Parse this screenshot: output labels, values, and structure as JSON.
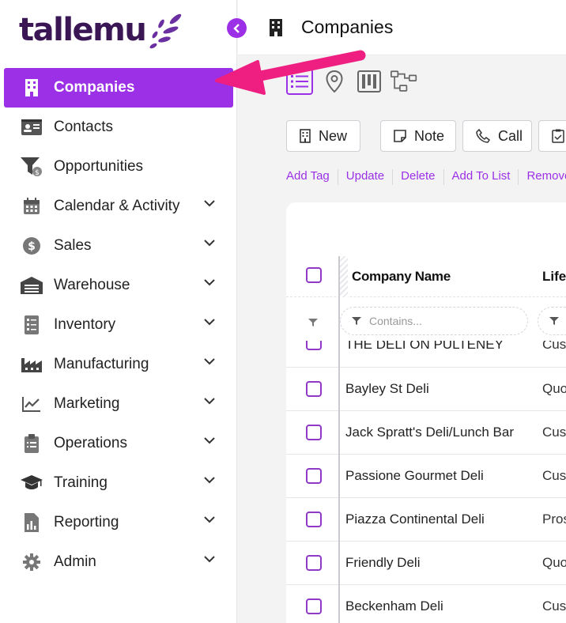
{
  "brand": {
    "name": "tallemu",
    "accent": "#9b30e6",
    "logo_color": "#3a1654"
  },
  "header": {
    "title": "Companies"
  },
  "sidebar": {
    "items": [
      {
        "label": "Companies",
        "icon": "building-icon",
        "active": true,
        "expandable": false
      },
      {
        "label": "Contacts",
        "icon": "id-card-icon",
        "expandable": false
      },
      {
        "label": "Opportunities",
        "icon": "funnel-dollar-icon",
        "expandable": false
      },
      {
        "label": "Calendar & Activity",
        "icon": "calendar-icon",
        "expandable": true
      },
      {
        "label": "Sales",
        "icon": "dollar-circle-icon",
        "expandable": true
      },
      {
        "label": "Warehouse",
        "icon": "warehouse-icon",
        "expandable": true
      },
      {
        "label": "Inventory",
        "icon": "checklist-icon",
        "expandable": true
      },
      {
        "label": "Manufacturing",
        "icon": "factory-icon",
        "expandable": true
      },
      {
        "label": "Marketing",
        "icon": "trend-chart-icon",
        "expandable": true
      },
      {
        "label": "Operations",
        "icon": "clipboard-icon",
        "expandable": true
      },
      {
        "label": "Training",
        "icon": "graduation-cap-icon",
        "expandable": true
      },
      {
        "label": "Reporting",
        "icon": "report-icon",
        "expandable": true
      },
      {
        "label": "Admin",
        "icon": "gear-icon",
        "expandable": true
      }
    ]
  },
  "views": [
    "list-view-icon",
    "map-pin-icon",
    "kanban-icon",
    "hierarchy-icon"
  ],
  "toolbar": {
    "new_label": "New",
    "note_label": "Note",
    "call_label": "Call"
  },
  "actions": [
    "Add Tag",
    "Update",
    "Delete",
    "Add To List",
    "Remove"
  ],
  "grid": {
    "columns": [
      "Company Name",
      "Life"
    ],
    "filter_placeholder": "Contains...",
    "rows": [
      {
        "name": "THE DELI ON PULTENEY",
        "life": "Cus"
      },
      {
        "name": "Bayley St Deli",
        "life": "Quo"
      },
      {
        "name": "Jack Spratt's Deli/Lunch Bar",
        "life": "Cus"
      },
      {
        "name": "Passione Gourmet Deli",
        "life": "Cus"
      },
      {
        "name": "Piazza Continental Deli",
        "life": "Pros"
      },
      {
        "name": "Friendly Deli",
        "life": "Quo"
      },
      {
        "name": "Beckenham Deli",
        "life": "Cus"
      }
    ]
  }
}
